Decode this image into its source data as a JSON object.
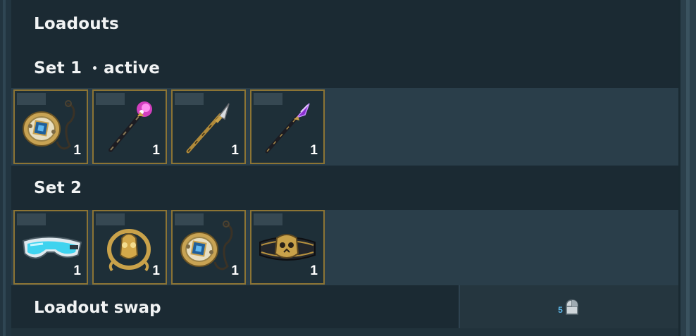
{
  "title": "Loadouts",
  "sets": [
    {
      "label": "Set 1",
      "status": "active",
      "items": [
        {
          "icon": "pocket-watch-icon",
          "qty": "1"
        },
        {
          "icon": "pink-orb-staff-icon",
          "qty": "1"
        },
        {
          "icon": "golden-spear-icon",
          "qty": "1"
        },
        {
          "icon": "purple-crystal-staff-icon",
          "qty": "1"
        }
      ]
    },
    {
      "label": "Set 2",
      "items": [
        {
          "icon": "cyan-goggles-icon",
          "qty": "1"
        },
        {
          "icon": "golden-amulet-icon",
          "qty": "1"
        },
        {
          "icon": "pocket-watch-icon",
          "qty": "1"
        },
        {
          "icon": "skull-belt-icon",
          "qty": "1"
        }
      ]
    }
  ],
  "swap": {
    "label": "Loadout swap",
    "key_number": "5",
    "key_icon": "mouse-button-icon"
  },
  "colors": {
    "slot_border": "#8c7434",
    "header_bg": "#1b2a33",
    "panel_bg": "#2a3e4a",
    "key_accent": "#5cb6e8"
  }
}
